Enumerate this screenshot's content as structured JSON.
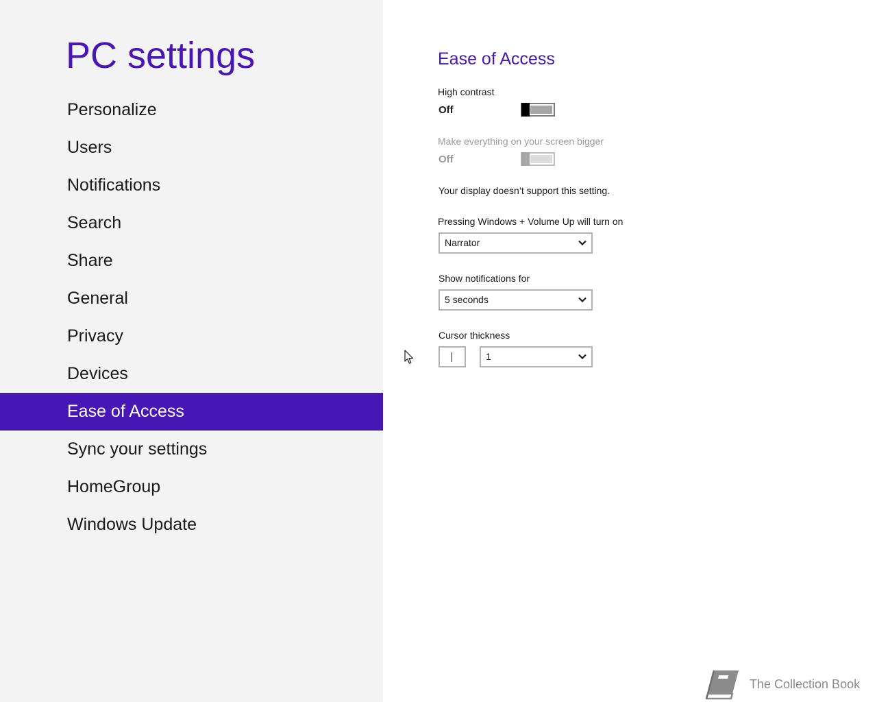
{
  "app": {
    "title": "PC settings",
    "accent_color": "#4617b4",
    "nav_background": "#f3f3f3"
  },
  "nav": {
    "items": [
      {
        "label": "Personalize",
        "selected": false
      },
      {
        "label": "Users",
        "selected": false
      },
      {
        "label": "Notifications",
        "selected": false
      },
      {
        "label": "Search",
        "selected": false
      },
      {
        "label": "Share",
        "selected": false
      },
      {
        "label": "General",
        "selected": false
      },
      {
        "label": "Privacy",
        "selected": false
      },
      {
        "label": "Devices",
        "selected": false
      },
      {
        "label": "Ease of Access",
        "selected": true
      },
      {
        "label": "Sync your settings",
        "selected": false
      },
      {
        "label": "HomeGroup",
        "selected": false
      },
      {
        "label": "Windows Update",
        "selected": false
      }
    ]
  },
  "content": {
    "title": "Ease of Access",
    "high_contrast": {
      "label": "High contrast",
      "state": "Off",
      "enabled": true
    },
    "bigger": {
      "label": "Make everything on your screen bigger",
      "state": "Off",
      "enabled": false
    },
    "display_note": "Your display doesn’t support this setting.",
    "volume_up": {
      "label": "Pressing Windows + Volume Up will turn on",
      "value": "Narrator"
    },
    "notifications": {
      "label": "Show notifications for",
      "value": "5 seconds"
    },
    "cursor": {
      "label": "Cursor thickness",
      "value": "1"
    }
  },
  "icons": {
    "chevron": "chevron-down-icon",
    "pointer": "mouse-pointer-icon",
    "watermark": "book-icon"
  },
  "watermark": {
    "text": "The Collection Book"
  }
}
